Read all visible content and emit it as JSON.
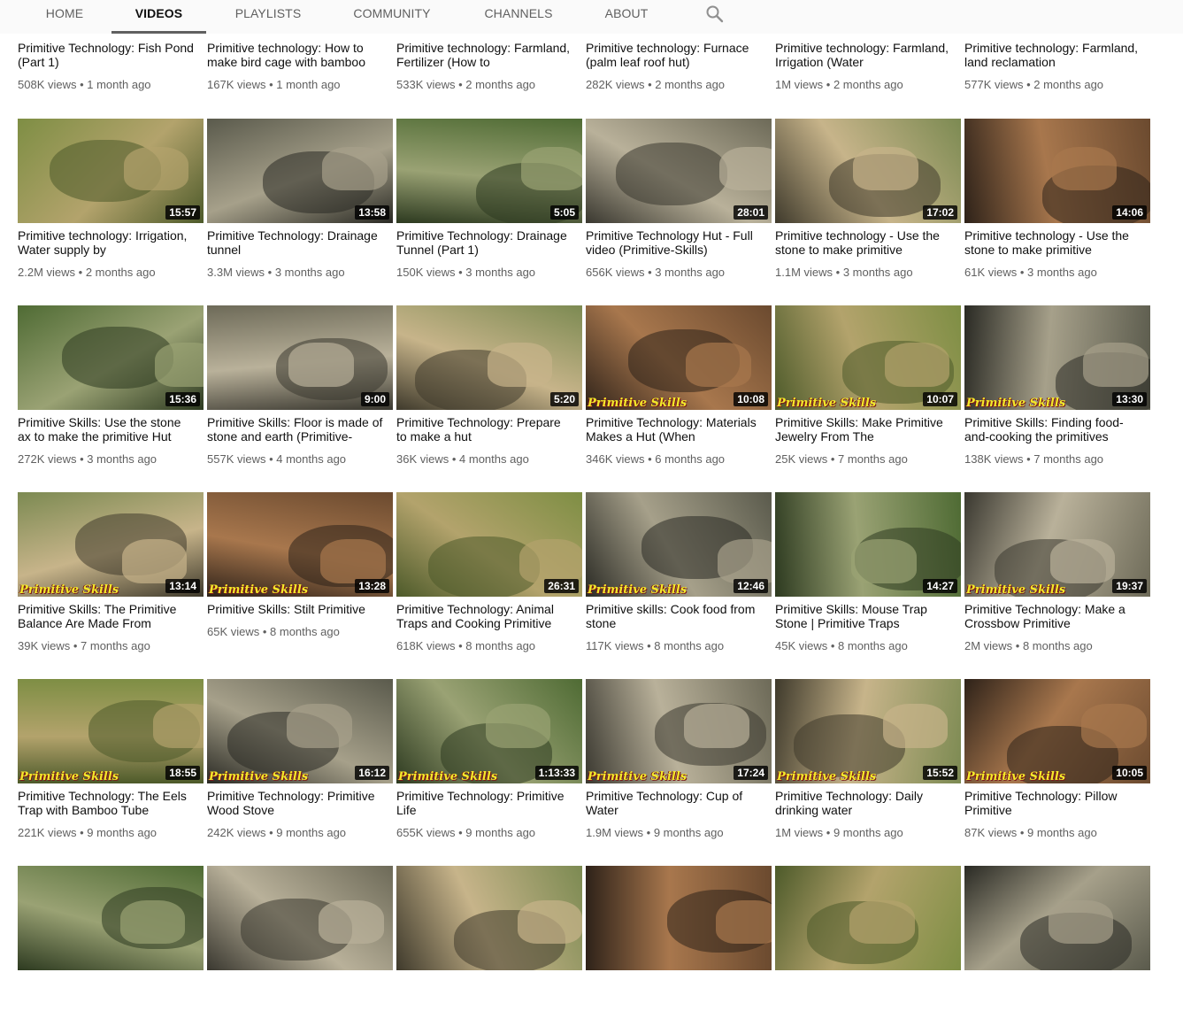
{
  "tabs": [
    {
      "label": "HOME",
      "active": false
    },
    {
      "label": "VIDEOS",
      "active": true
    },
    {
      "label": "PLAYLISTS",
      "active": false
    },
    {
      "label": "COMMUNITY",
      "active": false
    },
    {
      "label": "CHANNELS",
      "active": false
    },
    {
      "label": "ABOUT",
      "active": false
    }
  ],
  "search_icon": "search-icon",
  "watermark_text": "Primitive Skills",
  "rows": [
    [
      {
        "title": "Primitive Technology: Fish Pond (Part 1)",
        "views": "508K views",
        "age": "1 month ago"
      },
      {
        "title": "Primitive technology: How to make bird cage with bamboo",
        "views": "167K views",
        "age": "1 month ago"
      },
      {
        "title": "Primitive technology: Farmland, Fertilizer (How to",
        "views": "533K views",
        "age": "2 months ago"
      },
      {
        "title": "Primitive technology: Furnace (palm leaf roof hut)",
        "views": "282K views",
        "age": "2 months ago"
      },
      {
        "title": "Primitive technology: Farmland, Irrigation (Water",
        "views": "1M views",
        "age": "2 months ago"
      },
      {
        "title": "Primitive technology: Farmland, land reclamation",
        "views": "577K views",
        "age": "2 months ago"
      }
    ],
    [
      {
        "title": "Primitive technology: Irrigation, Water supply by",
        "views": "2.2M views",
        "age": "2 months ago",
        "duration": "15:57"
      },
      {
        "title": "Primitive Technology: Drainage tunnel",
        "views": "3.3M views",
        "age": "3 months ago",
        "duration": "13:58"
      },
      {
        "title": "Primitive Technology: Drainage Tunnel (Part 1)",
        "views": "150K views",
        "age": "3 months ago",
        "duration": "5:05"
      },
      {
        "title": "Primitive Technology Hut - Full video (Primitive-Skills)",
        "views": "656K views",
        "age": "3 months ago",
        "duration": "28:01"
      },
      {
        "title": "Primitive technology - Use the stone to make primitive",
        "views": "1.1M views",
        "age": "3 months ago",
        "duration": "17:02"
      },
      {
        "title": "Primitive technology - Use the stone to make primitive",
        "views": "61K views",
        "age": "3 months ago",
        "duration": "14:06"
      }
    ],
    [
      {
        "title": "Primitive Skills: Use the stone ax to make the primitive Hut",
        "views": "272K views",
        "age": "3 months ago",
        "duration": "15:36"
      },
      {
        "title": "Primitive Skills: Floor is made of stone and earth (Primitive-",
        "views": "557K views",
        "age": "4 months ago",
        "duration": "9:00"
      },
      {
        "title": "Primitive Technology: Prepare to make a hut",
        "views": "36K views",
        "age": "4 months ago",
        "duration": "5:20"
      },
      {
        "title": "Primitive Technology: Materials Makes a Hut (When",
        "views": "346K views",
        "age": "6 months ago",
        "duration": "10:08",
        "wm": true
      },
      {
        "title": "Primitive Skills: Make Primitive Jewelry From The",
        "views": "25K views",
        "age": "7 months ago",
        "duration": "10:07",
        "wm": true
      },
      {
        "title": "Primitive Skills: Finding food-and-cooking the primitives",
        "views": "138K views",
        "age": "7 months ago",
        "duration": "13:30",
        "wm": true
      }
    ],
    [
      {
        "title": "Primitive Skills: The Primitive Balance Are Made From",
        "views": "39K views",
        "age": "7 months ago",
        "duration": "13:14",
        "wm": true
      },
      {
        "title": "Primitive Skills: Stilt Primitive",
        "views": "65K views",
        "age": "8 months ago",
        "duration": "13:28",
        "wm": true,
        "one": true
      },
      {
        "title": "Primitive Technology: Animal Traps and Cooking Primitive",
        "views": "618K views",
        "age": "8 months ago",
        "duration": "26:31"
      },
      {
        "title": "Primitive skills: Cook food from stone",
        "views": "117K views",
        "age": "8 months ago",
        "duration": "12:46",
        "wm": true
      },
      {
        "title": "Primitive Skills: Mouse Trap Stone | Primitive Traps",
        "views": "45K views",
        "age": "8 months ago",
        "duration": "14:27"
      },
      {
        "title": "Primitive Technology: Make a Crossbow Primitive",
        "views": "2M views",
        "age": "8 months ago",
        "duration": "19:37",
        "wm": true
      }
    ],
    [
      {
        "title": "Primitive Technology: The Eels Trap with Bamboo Tube",
        "views": "221K views",
        "age": "9 months ago",
        "duration": "18:55",
        "wm": true
      },
      {
        "title": "Primitive Technology: Primitive Wood Stove",
        "views": "242K views",
        "age": "9 months ago",
        "duration": "16:12",
        "wm": true
      },
      {
        "title": "Primitive Technology: Primitive Life",
        "views": "655K views",
        "age": "9 months ago",
        "duration": "1:13:33",
        "wm": true
      },
      {
        "title": "Primitive Technology: Cup of Water",
        "views": "1.9M views",
        "age": "9 months ago",
        "duration": "17:24",
        "wm": true
      },
      {
        "title": "Primitive Technology: Daily drinking water",
        "views": "1M views",
        "age": "9 months ago",
        "duration": "15:52",
        "wm": true
      },
      {
        "title": "Primitive Technology: Pillow Primitive",
        "views": "87K views",
        "age": "9 months ago",
        "duration": "10:05",
        "wm": true
      }
    ],
    [
      {
        "title": "",
        "views": "",
        "age": ""
      },
      {
        "title": "",
        "views": "",
        "age": ""
      },
      {
        "title": "",
        "views": "",
        "age": ""
      },
      {
        "title": "",
        "views": "",
        "age": ""
      },
      {
        "title": "",
        "views": "",
        "age": ""
      },
      {
        "title": "",
        "views": "",
        "age": ""
      }
    ]
  ]
}
